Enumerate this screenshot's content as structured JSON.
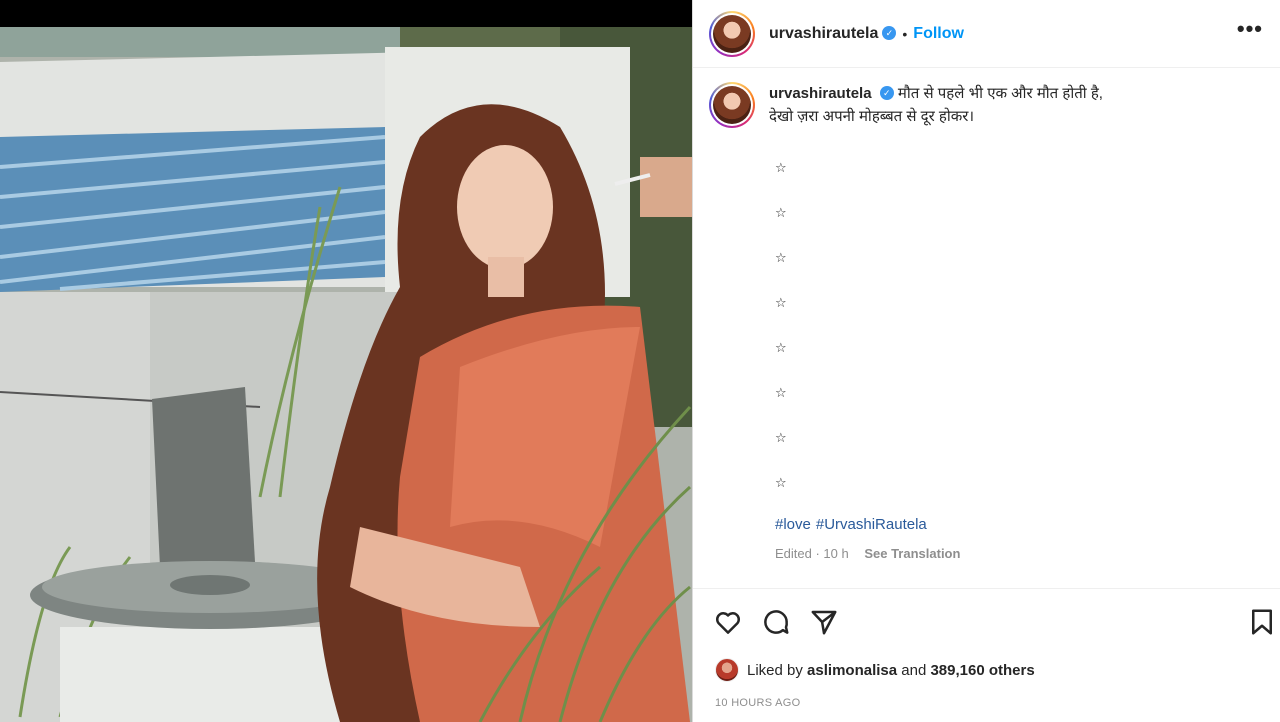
{
  "post": {
    "username": "urvashirautela",
    "follow_label": "Follow",
    "separator": "•",
    "more_label": "•••",
    "caption_line1": "मौत से पहले भी एक और मौत होती है,",
    "caption_line2": "देखो ज़रा अपनी मोहब्बत से दूर होकर।",
    "stars": [
      "☆",
      "☆",
      "☆",
      "☆",
      "☆",
      "☆",
      "☆",
      "☆"
    ],
    "hashtags": [
      "#love",
      "#UrvashiRautela"
    ],
    "edited_label": "Edited · 10 h",
    "see_translation": "See Translation",
    "likes_prefix": "Liked by",
    "liked_by_user": "aslimonalisa",
    "likes_mid": "and",
    "likes_count": "389,160 others",
    "timestamp": "10 HOURS AGO"
  },
  "icons": {
    "verified": "verified-badge-icon",
    "like": "heart-icon",
    "comment": "comment-icon",
    "share": "paper-plane-icon",
    "save": "bookmark-icon"
  },
  "colors": {
    "follow": "#0095f6",
    "verified": "#3897f0",
    "hashtag": "#2a5a9a",
    "muted": "#8e8e8e"
  }
}
